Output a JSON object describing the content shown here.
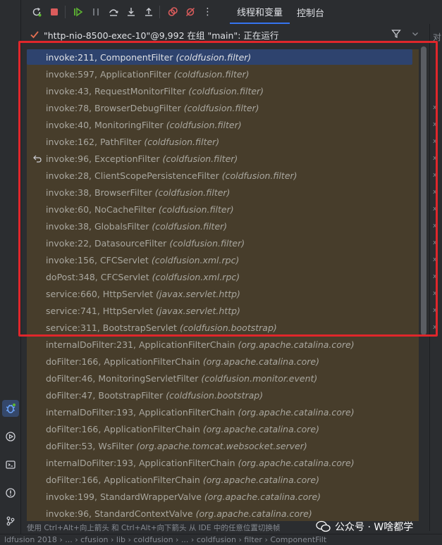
{
  "toolbar": {
    "tabs": [
      {
        "label": "线程和变量",
        "active": true
      },
      {
        "label": "控制台",
        "active": false
      }
    ],
    "more_label": "⋮"
  },
  "thread": {
    "label": "\"http-nio-8500-exec-10\"@9,992 在组 \"main\": 正在运行"
  },
  "right_strip": {
    "top_char": "对",
    "marks": [
      "x",
      "x",
      "x",
      "x",
      "x",
      "x",
      "x",
      "x",
      "x",
      "x",
      "x",
      "x",
      "x",
      "x"
    ]
  },
  "frames": [
    {
      "method": "invoke:211, ComponentFilter",
      "pkg": "(coldfusion.filter)",
      "selected": true
    },
    {
      "method": "invoke:597, ApplicationFilter",
      "pkg": "(coldfusion.filter)"
    },
    {
      "method": "invoke:43, RequestMonitorFilter",
      "pkg": "(coldfusion.filter)"
    },
    {
      "method": "invoke:78, BrowserDebugFilter",
      "pkg": "(coldfusion.filter)"
    },
    {
      "method": "invoke:40, MonitoringFilter",
      "pkg": "(coldfusion.filter)"
    },
    {
      "method": "invoke:162, PathFilter",
      "pkg": "(coldfusion.filter)"
    },
    {
      "method": "invoke:96, ExceptionFilter",
      "pkg": "(coldfusion.filter)",
      "ret_icon": true
    },
    {
      "method": "invoke:28, ClientScopePersistenceFilter",
      "pkg": "(coldfusion.filter)"
    },
    {
      "method": "invoke:38, BrowserFilter",
      "pkg": "(coldfusion.filter)"
    },
    {
      "method": "invoke:60, NoCacheFilter",
      "pkg": "(coldfusion.filter)"
    },
    {
      "method": "invoke:38, GlobalsFilter",
      "pkg": "(coldfusion.filter)"
    },
    {
      "method": "invoke:22, DatasourceFilter",
      "pkg": "(coldfusion.filter)"
    },
    {
      "method": "invoke:156, CFCServlet",
      "pkg": "(coldfusion.xml.rpc)"
    },
    {
      "method": "doPost:348, CFCServlet",
      "pkg": "(coldfusion.xml.rpc)"
    },
    {
      "method": "service:660, HttpServlet",
      "pkg": "(javax.servlet.http)"
    },
    {
      "method": "service:741, HttpServlet",
      "pkg": "(javax.servlet.http)"
    },
    {
      "method": "service:311, BootstrapServlet",
      "pkg": "(coldfusion.bootstrap)"
    },
    {
      "method": "internalDoFilter:231, ApplicationFilterChain",
      "pkg": "(org.apache.catalina.core)"
    },
    {
      "method": "doFilter:166, ApplicationFilterChain",
      "pkg": "(org.apache.catalina.core)"
    },
    {
      "method": "doFilter:46, MonitoringServletFilter",
      "pkg": "(coldfusion.monitor.event)"
    },
    {
      "method": "doFilter:47, BootstrapFilter",
      "pkg": "(coldfusion.bootstrap)"
    },
    {
      "method": "internalDoFilter:193, ApplicationFilterChain",
      "pkg": "(org.apache.catalina.core)"
    },
    {
      "method": "doFilter:166, ApplicationFilterChain",
      "pkg": "(org.apache.catalina.core)"
    },
    {
      "method": "doFilter:53, WsFilter",
      "pkg": "(org.apache.tomcat.websocket.server)"
    },
    {
      "method": "internalDoFilter:193, ApplicationFilterChain",
      "pkg": "(org.apache.catalina.core)"
    },
    {
      "method": "doFilter:166, ApplicationFilterChain",
      "pkg": "(org.apache.catalina.core)"
    },
    {
      "method": "invoke:199, StandardWrapperValve",
      "pkg": "(org.apache.catalina.core)"
    },
    {
      "method": "invoke:96, StandardContextValve",
      "pkg": "(org.apache.catalina.core)"
    }
  ],
  "footer": {
    "hint": "使用 Ctrl+Alt+向上箭头 和 Ctrl+Alt+向下箭头 从 IDE 中的任意位置切换帧",
    "watermark": "公众号 · W啥都学",
    "status_path": "ldfusion 2018 › ... › cfusion › lib › coldfusion › ... › coldfusion › filter › ComponentFilt"
  },
  "colors": {
    "accent": "#3574f0",
    "highlight_box": "#e0262b",
    "frames_bg": "#473d2b",
    "selected_row": "#2e436e"
  }
}
